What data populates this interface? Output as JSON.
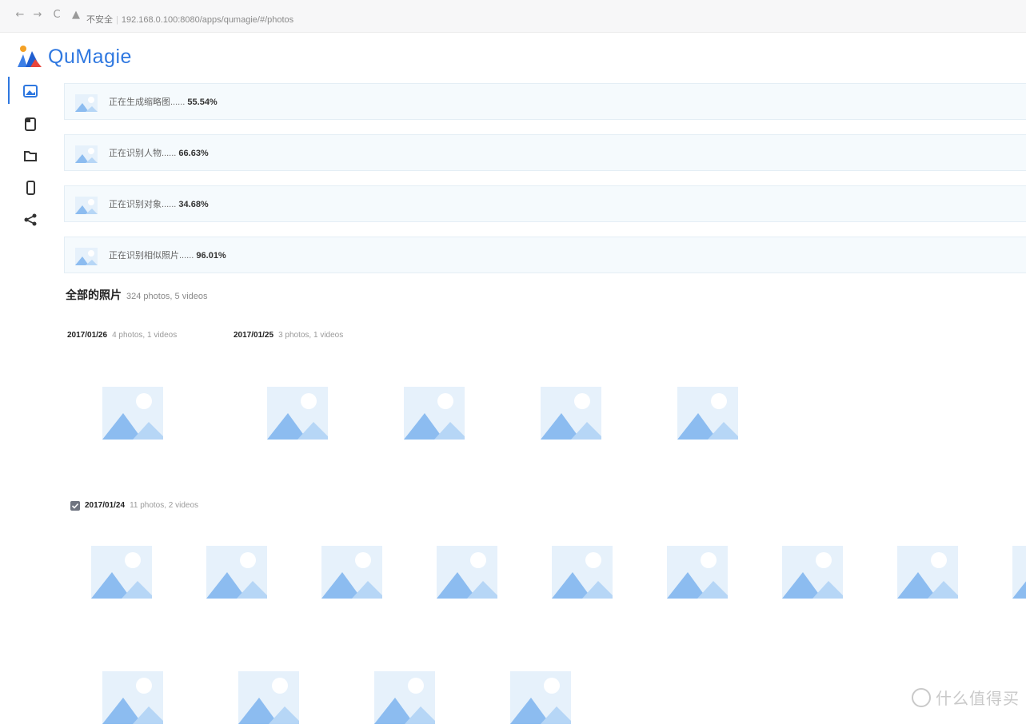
{
  "browser": {
    "back": "←",
    "forward": "→",
    "reload": "C",
    "security": "不安全",
    "url": "192.168.0.100:8080/apps/qumagie/#/photos"
  },
  "app": {
    "name": "QuMagie"
  },
  "sidebar": {
    "items": [
      {
        "name": "photos",
        "icon": "photo-icon"
      },
      {
        "name": "albums",
        "icon": "album-icon"
      },
      {
        "name": "folders",
        "icon": "folder-icon"
      },
      {
        "name": "devices",
        "icon": "phone-icon"
      },
      {
        "name": "share",
        "icon": "share-icon"
      }
    ]
  },
  "tasks": [
    {
      "label": "正在生成缩略图......",
      "percent": "55.54%"
    },
    {
      "label": "正在识别人物......",
      "percent": "66.63%"
    },
    {
      "label": "正在识别对象......",
      "percent": "34.68%"
    },
    {
      "label": "正在识别相似照片......",
      "percent": "96.01%"
    }
  ],
  "section": {
    "title": "全部的照片",
    "count": "324 photos, 5 videos"
  },
  "groups": [
    {
      "date": "2017/01/26",
      "count": "4 photos, 1 videos"
    },
    {
      "date": "2017/01/25",
      "count": "3 photos, 1 videos"
    },
    {
      "date": "2017/01/24",
      "count": "11 photos, 2 videos"
    }
  ],
  "watermark": "什么值得买",
  "colors": {
    "accent": "#2f78e0",
    "placeholder_sky": "#e6f1fb",
    "placeholder_hill": "#8cbcf0"
  }
}
